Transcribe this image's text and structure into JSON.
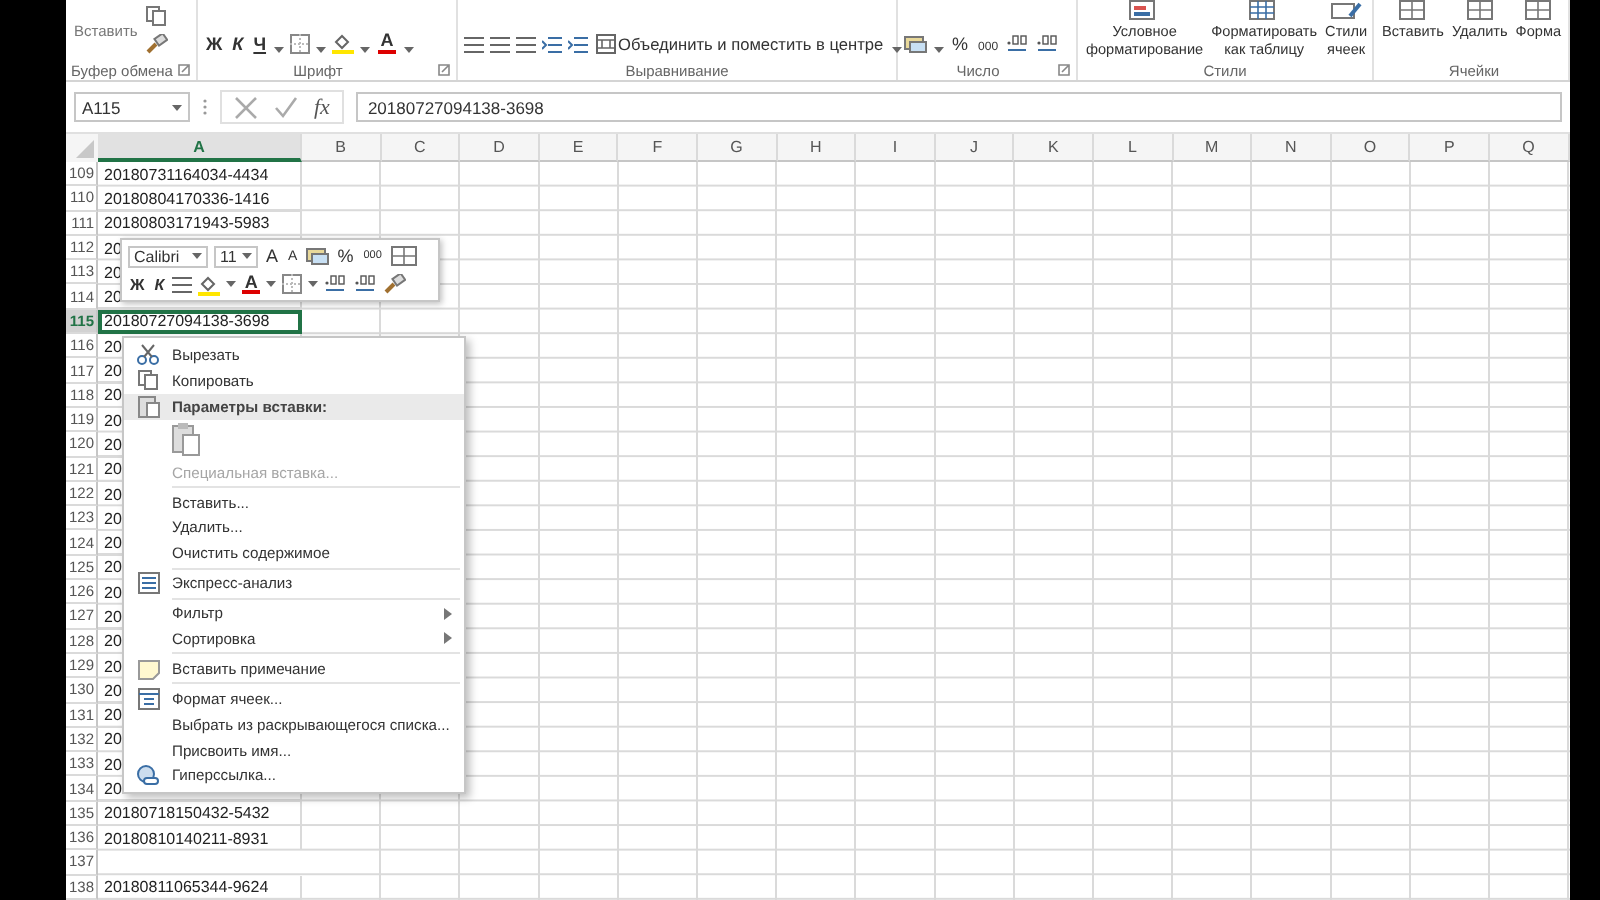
{
  "ribbon": {
    "groups": [
      {
        "kind": "clipboard",
        "label": "Буфер обмена",
        "paste": "Вставить"
      },
      {
        "kind": "font",
        "label": "Шрифт",
        "bold": "Ж",
        "italic": "К",
        "underline": "Ч",
        "font_color": "A"
      },
      {
        "kind": "alignment",
        "label": "Выравнивание",
        "merge": "Объединить и поместить в центре"
      },
      {
        "kind": "number",
        "label": "Число",
        "percent": "%",
        "thousands": "000"
      },
      {
        "kind": "styles",
        "label": "Стили",
        "buttons": [
          {
            "lines": [
              "Условное",
              "форматирование"
            ]
          },
          {
            "lines": [
              "Форматировать",
              "как таблицу"
            ]
          },
          {
            "lines": [
              "Стили",
              "ячеек"
            ]
          }
        ]
      },
      {
        "kind": "cells",
        "label": "Ячейки",
        "buttons": [
          {
            "lines": [
              "Вставить"
            ]
          },
          {
            "lines": [
              "Удалить"
            ]
          },
          {
            "lines": [
              "Форма"
            ]
          }
        ]
      }
    ]
  },
  "formula_bar": {
    "name_box": "A115",
    "fx": "fx",
    "formula": "20180727094138-3698"
  },
  "columns": [
    {
      "label": "A",
      "selected": true
    },
    {
      "label": "B",
      "selected": false
    },
    {
      "label": "C",
      "selected": false
    },
    {
      "label": "D",
      "selected": false
    },
    {
      "label": "E",
      "selected": false
    },
    {
      "label": "F",
      "selected": false
    },
    {
      "label": "G",
      "selected": false
    },
    {
      "label": "H",
      "selected": false
    },
    {
      "label": "I",
      "selected": false
    },
    {
      "label": "J",
      "selected": false
    },
    {
      "label": "K",
      "selected": false
    },
    {
      "label": "L",
      "selected": false
    },
    {
      "label": "M",
      "selected": false
    },
    {
      "label": "N",
      "selected": false
    },
    {
      "label": "O",
      "selected": false
    },
    {
      "label": "P",
      "selected": false
    },
    {
      "label": "Q",
      "selected": false
    }
  ],
  "rows": [
    {
      "number": "109",
      "value": "20180731164034-4434",
      "selected": false
    },
    {
      "number": "110",
      "value": "20180804170336-1416",
      "selected": false
    },
    {
      "number": "111",
      "value": "20180803171943-5983",
      "selected": false
    },
    {
      "number": "112",
      "value": "20",
      "selected": false
    },
    {
      "number": "113",
      "value": "20",
      "selected": false
    },
    {
      "number": "114",
      "value": "20",
      "selected": false
    },
    {
      "number": "115",
      "value": "20180727094138-3698",
      "selected": true
    },
    {
      "number": "116",
      "value": "20",
      "selected": false
    },
    {
      "number": "117",
      "value": "20",
      "selected": false
    },
    {
      "number": "118",
      "value": "20",
      "selected": false
    },
    {
      "number": "119",
      "value": "20",
      "selected": false
    },
    {
      "number": "120",
      "value": "20",
      "selected": false
    },
    {
      "number": "121",
      "value": "20",
      "selected": false
    },
    {
      "number": "122",
      "value": "20",
      "selected": false
    },
    {
      "number": "123",
      "value": "20",
      "selected": false
    },
    {
      "number": "124",
      "value": "20",
      "selected": false
    },
    {
      "number": "125",
      "value": "20",
      "selected": false
    },
    {
      "number": "126",
      "value": "20",
      "selected": false
    },
    {
      "number": "127",
      "value": "20",
      "selected": false
    },
    {
      "number": "128",
      "value": "20",
      "selected": false
    },
    {
      "number": "129",
      "value": "20",
      "selected": false
    },
    {
      "number": "130",
      "value": "20",
      "selected": false
    },
    {
      "number": "131",
      "value": "20",
      "selected": false
    },
    {
      "number": "132",
      "value": "20",
      "selected": false
    },
    {
      "number": "133",
      "value": "20",
      "selected": false
    },
    {
      "number": "134",
      "value": "20",
      "selected": false
    },
    {
      "number": "135",
      "value": "20180718150432-5432",
      "selected": false
    },
    {
      "number": "136",
      "value": "20180810140211-8931",
      "selected": false
    },
    {
      "number": "137",
      "selected": false
    },
    {
      "number": "138",
      "value": "20180811065344-9624",
      "selected": false
    }
  ],
  "mini_toolbar": {
    "font": "Calibri",
    "size": "11",
    "grow": "A",
    "shrink": "A",
    "percent": "%",
    "thousands": "000",
    "bold": "Ж",
    "italic": "К",
    "font_color": "A"
  },
  "context_menu": {
    "items": [
      {
        "kind": "item",
        "label": "Вырезать",
        "disabled": false,
        "submenu": false
      },
      {
        "kind": "item",
        "label": "Копировать",
        "disabled": false,
        "submenu": false
      },
      {
        "kind": "header",
        "label": "Параметры вставки:"
      },
      {
        "kind": "paste-options"
      },
      {
        "kind": "item",
        "label": "Специальная вставка...",
        "disabled": true,
        "submenu": false
      },
      {
        "kind": "separator"
      },
      {
        "kind": "item",
        "label": "Вставить...",
        "disabled": false,
        "submenu": false
      },
      {
        "kind": "item",
        "label": "Удалить...",
        "disabled": false,
        "submenu": false
      },
      {
        "kind": "item",
        "label": "Очистить содержимое",
        "disabled": false,
        "submenu": false
      },
      {
        "kind": "separator"
      },
      {
        "kind": "item",
        "label": "Экспресс-анализ",
        "disabled": false,
        "submenu": false
      },
      {
        "kind": "separator"
      },
      {
        "kind": "item",
        "label": "Фильтр",
        "disabled": false,
        "submenu": true
      },
      {
        "kind": "item",
        "label": "Сортировка",
        "disabled": false,
        "submenu": true
      },
      {
        "kind": "separator"
      },
      {
        "kind": "item",
        "label": "Вставить примечание",
        "disabled": false,
        "submenu": false
      },
      {
        "kind": "separator"
      },
      {
        "kind": "item",
        "label": "Формат ячеек...",
        "disabled": false,
        "submenu": false
      },
      {
        "kind": "item",
        "label": "Выбрать из раскрывающегося списка...",
        "disabled": false,
        "submenu": false
      },
      {
        "kind": "item",
        "label": "Присвоить имя...",
        "disabled": false,
        "submenu": false
      },
      {
        "kind": "item",
        "label": "Гиперссылка...",
        "disabled": false,
        "submenu": false
      }
    ]
  }
}
